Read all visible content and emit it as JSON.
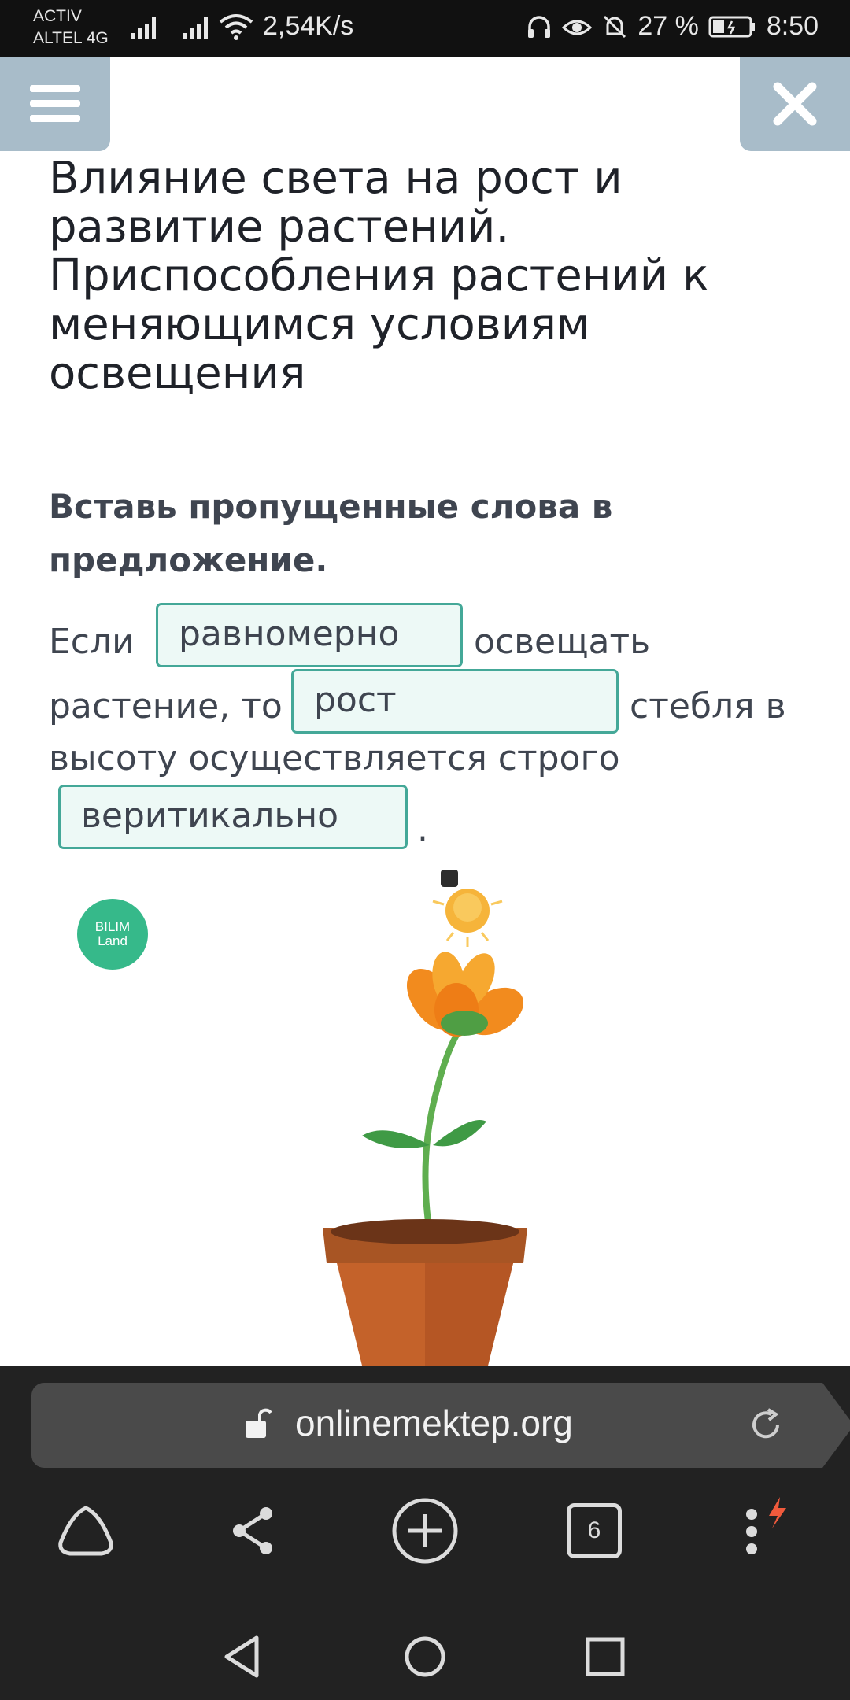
{
  "status_bar": {
    "carrier_line1": "ACTIV",
    "carrier_line2": "ALTEL 4G",
    "net_speed": "2,54K/s",
    "battery": "27 %",
    "time": "8:50"
  },
  "page": {
    "title": "Влияние света на рост и развитие растений. Приспособления растений к меняющимся условиям освещения",
    "task_heading": "Вставь пропущенные слова в предложение.",
    "sentence": {
      "part1": "Если",
      "part2": "освещать",
      "part3": "растение, то",
      "part4": "стебля в",
      "part5": "высоту осуществляется строго",
      "part6": ".",
      "blank1_value": "равномерно",
      "blank2_value": "рост",
      "blank3_value": "веритикально"
    },
    "logo_text_1": "BILIM",
    "logo_text_2": "Land"
  },
  "browser": {
    "url": "onlinemektep.org",
    "tabs_count": "6"
  },
  "colors": {
    "status_bar_bg": "#111111",
    "header_button_bg": "#a8bcc9",
    "blank_border": "#44a898",
    "blank_bg": "#edf9f6",
    "logo_bg": "#36b98a",
    "browser_bg": "#222222"
  }
}
